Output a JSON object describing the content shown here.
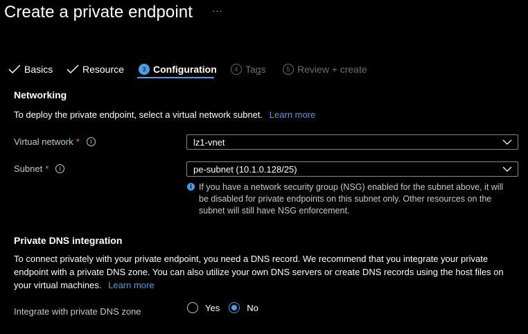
{
  "page": {
    "title": "Create a private endpoint",
    "more": "···"
  },
  "steps": [
    {
      "label": "Basics",
      "state": "done"
    },
    {
      "label": "Resource",
      "state": "done"
    },
    {
      "number": "3",
      "label": "Configuration",
      "state": "active"
    },
    {
      "number": "4",
      "label": "Tags",
      "state": "disabled"
    },
    {
      "number": "5",
      "label": "Review + create",
      "state": "disabled"
    }
  ],
  "networking": {
    "heading": "Networking",
    "description": "To deploy the private endpoint, select a virtual network subnet.",
    "learn_more": "Learn more",
    "virtual_network": {
      "label": "Virtual network",
      "required": "*",
      "value": "lz1-vnet"
    },
    "subnet": {
      "label": "Subnet",
      "required": "*",
      "value": "pe-subnet (10.1.0.128/25)"
    },
    "nsg_info": "If you have a network security group (NSG) enabled for the subnet above, it will be disabled for private endpoints on this subnet only. Other resources on the subnet will still have NSG enforcement."
  },
  "dns": {
    "heading": "Private DNS integration",
    "description": "To connect privately with your private endpoint, you need a DNS record. We recommend that you integrate your private endpoint with a private DNS zone. You can also utilize your own DNS servers or create DNS records using the host files on your virtual machines.",
    "learn_more": "Learn more",
    "integrate_label": "Integrate with private DNS zone",
    "options": [
      "Yes",
      "No"
    ],
    "selected": "No"
  },
  "colors": {
    "accent": "#4f9ce6",
    "background": "#000000",
    "required": "#f1707b"
  }
}
